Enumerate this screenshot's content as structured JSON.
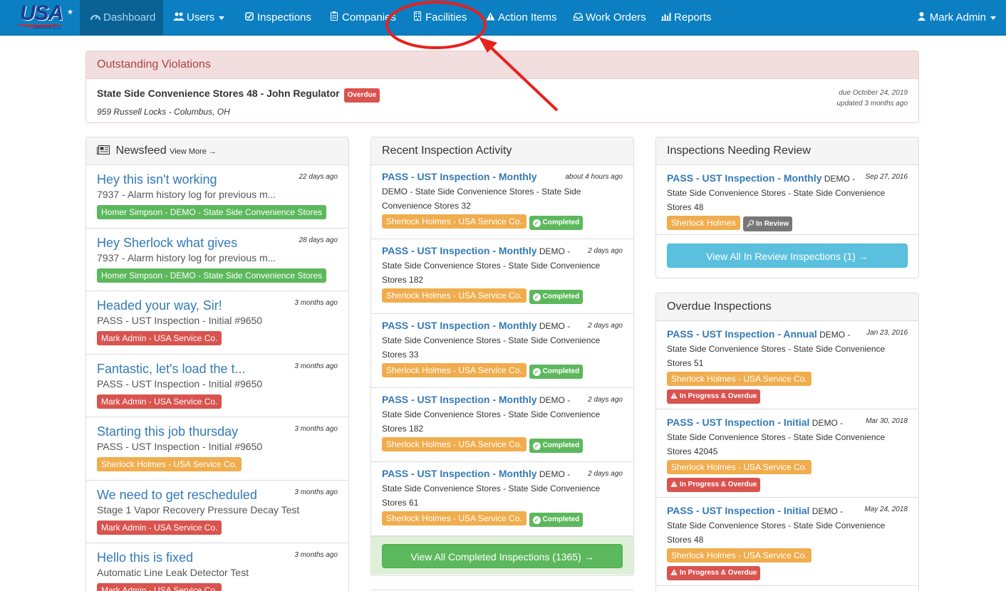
{
  "nav": {
    "logo": "USA",
    "logo_sub": "Service Co.",
    "items": [
      {
        "label": "Dashboard",
        "icon": "dashboard-icon"
      },
      {
        "label": "Users",
        "icon": "users-icon"
      },
      {
        "label": "Inspections",
        "icon": "check-square-icon"
      },
      {
        "label": "Companies",
        "icon": "clipboard-icon"
      },
      {
        "label": "Facilities",
        "icon": "building-icon"
      },
      {
        "label": "Action Items",
        "icon": "warning-icon"
      },
      {
        "label": "Work Orders",
        "icon": "inbox-icon"
      },
      {
        "label": "Reports",
        "icon": "bar-chart-icon"
      }
    ],
    "user": "Mark Admin"
  },
  "violations": {
    "title": "Outstanding Violations",
    "item": {
      "name": "State Side Convenience Stores 48 - John Regulator",
      "badge": "Overdue",
      "address": "959 Russell Locks - Columbus, OH",
      "due": "due October 24, 2019",
      "updated": "updated 3 months ago"
    }
  },
  "newsfeed": {
    "title": "Newsfeed",
    "view_more": "View More →",
    "items": [
      {
        "title": "Hey this isn't working",
        "sub": "7937 - Alarm history log for previous m...",
        "time": "22 days ago",
        "tag": "Homer Simpson - DEMO - State Side Convenience Stores",
        "color": "green"
      },
      {
        "title": "Hey Sherlock what gives",
        "sub": "7937 - Alarm history log for previous m...",
        "time": "28 days ago",
        "tag": "Homer Simpson - DEMO - State Side Convenience Stores",
        "color": "green"
      },
      {
        "title": "Headed your way, Sir!",
        "sub": "PASS - UST Inspection - Initial #9650",
        "time": "3 months ago",
        "tag": "Mark Admin - USA Service Co.",
        "color": "red"
      },
      {
        "title": "Fantastic, let's load the t...",
        "sub": "PASS - UST Inspection - Initial #9650",
        "time": "3 months ago",
        "tag": "Mark Admin - USA Service Co.",
        "color": "red"
      },
      {
        "title": "Starting this job thursday",
        "sub": "PASS - UST Inspection - Initial #9650",
        "time": "3 months ago",
        "tag": "Sherlock Holmes - USA Service Co.",
        "color": "orange"
      },
      {
        "title": "We need to get rescheduled",
        "sub": "Stage 1 Vapor Recovery Pressure Decay Test",
        "time": "3 months ago",
        "tag": "Mark Admin - USA Service Co.",
        "color": "red"
      },
      {
        "title": "Hello this is fixed",
        "sub": "Automatic Line Leak Detector Test",
        "time": "3 months ago",
        "tag": "Mark Admin - USA Service Co.",
        "color": "red"
      }
    ]
  },
  "recent": {
    "title": "Recent Inspection Activity",
    "items": [
      {
        "title": "PASS - UST Inspection - Monthly",
        "line1": "",
        "line2": "DEMO - State Side Convenience Stores - State Side",
        "line3": "Convenience Stores 32",
        "time": "about 4 hours ago",
        "tag": "Sherlock Holmes - USA Service Co.",
        "status": "Completed"
      },
      {
        "title": "PASS - UST Inspection - Monthly",
        "line1": "DEMO -",
        "line2": "State Side Convenience Stores - State Side Convenience",
        "line3": "Stores 182",
        "time": "2 days ago",
        "tag": "Sherlock Holmes - USA Service Co.",
        "status": "Completed"
      },
      {
        "title": "PASS - UST Inspection - Monthly",
        "line1": "DEMO -",
        "line2": "State Side Convenience Stores - State Side Convenience",
        "line3": "Stores 33",
        "time": "2 days ago",
        "tag": "Sherlock Holmes - USA Service Co.",
        "status": "Completed"
      },
      {
        "title": "PASS - UST Inspection - Monthly",
        "line1": "DEMO -",
        "line2": "State Side Convenience Stores - State Side Convenience",
        "line3": "Stores 182",
        "time": "2 days ago",
        "tag": "Sherlock Holmes - USA Service Co.",
        "status": "Completed"
      },
      {
        "title": "PASS - UST Inspection - Monthly",
        "line1": "DEMO -",
        "line2": "State Side Convenience Stores - State Side Convenience",
        "line3": "Stores 61",
        "time": "2 days ago",
        "tag": "Sherlock Holmes - USA Service Co.",
        "status": "Completed"
      }
    ],
    "button": "View All Completed Inspections (1365) →"
  },
  "review": {
    "title": "Inspections Needing Review",
    "item": {
      "title": "PASS - UST Inspection - Monthly",
      "line1": "DEMO -",
      "line2": "State Side Convenience Stores - State Side Convenience",
      "line3": "Stores 48",
      "time": "Sep 27, 2016",
      "tag": "Sherlock Holmes",
      "status": "In Review"
    },
    "button": "View All In Review Inspections (1) →"
  },
  "overdue": {
    "title": "Overdue Inspections",
    "items": [
      {
        "title": "PASS - UST Inspection - Annual",
        "line1": "DEMO -",
        "line2": "State Side Convenience Stores - State Side Convenience",
        "line3": "Stores 51",
        "time": "Jan 23, 2016",
        "tag": "Sherlock Holmes - USA Service Co.",
        "status": "In Progress & Overdue"
      },
      {
        "title": "PASS - UST Inspection - Initial",
        "line1": "DEMO -",
        "line2": "State Side Convenience Stores - State Side Convenience",
        "line3": "Stores 42045",
        "time": "Mar 30, 2018",
        "tag": "Sherlock Holmes - USA Service Co.",
        "status": "In Progress & Overdue"
      },
      {
        "title": "PASS - UST Inspection - Initial",
        "line1": "DEMO -",
        "line2": "State Side Convenience Stores - State Side Convenience",
        "line3": "Stores 48",
        "time": "May 24, 2018",
        "tag": "Sherlock Holmes - USA Service Co.",
        "status": "In Progress & Overdue"
      }
    ]
  },
  "colors": {
    "navbar": "#0b7fc2",
    "link": "#337ab7",
    "annotation": "#e8211d"
  }
}
